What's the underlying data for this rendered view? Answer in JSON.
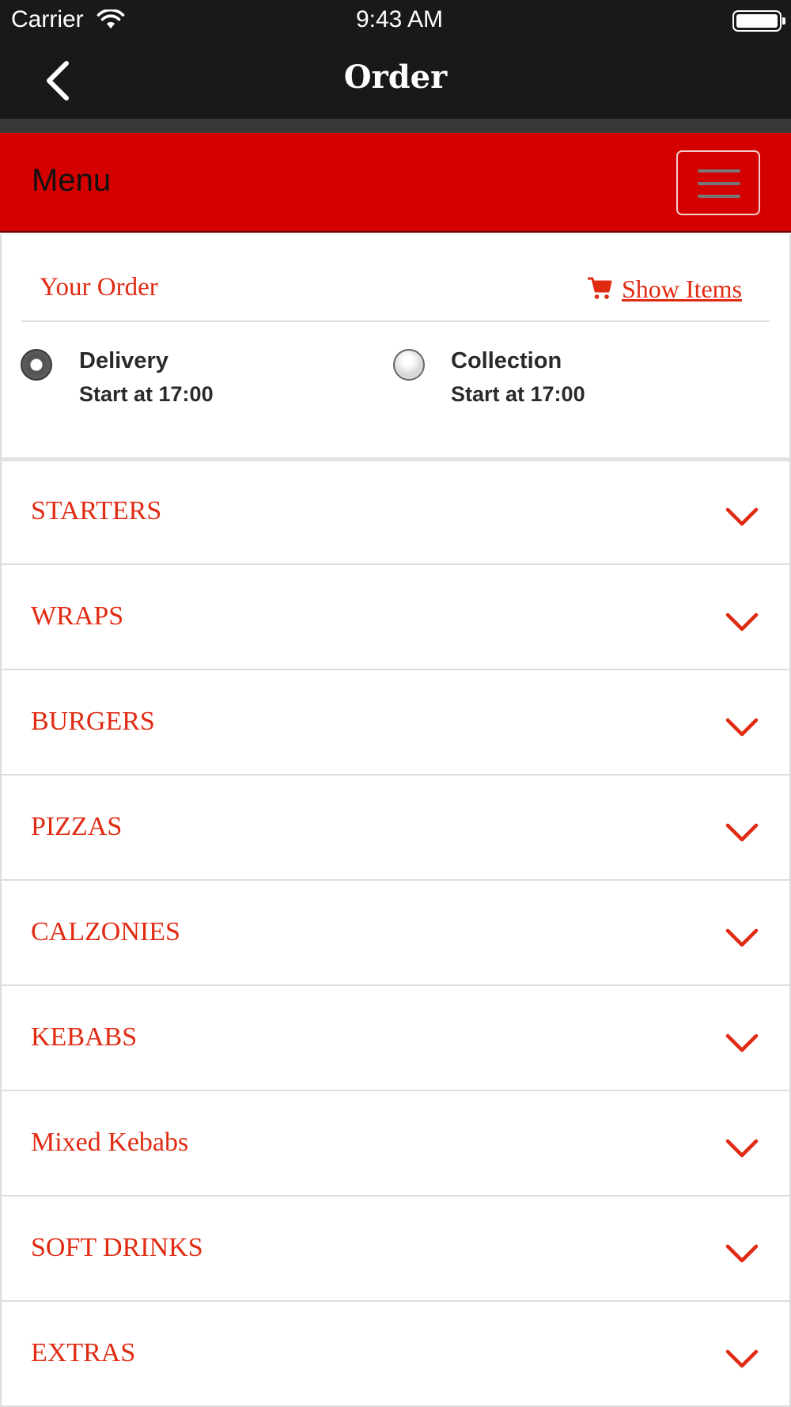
{
  "status_bar": {
    "carrier": "Carrier",
    "time": "9:43 AM"
  },
  "nav": {
    "title": "Order",
    "back_icon": "chevron-left-icon"
  },
  "menu_bar": {
    "label": "Menu",
    "toggle_icon": "hamburger-icon",
    "color": "#d40000"
  },
  "order": {
    "title": "Your Order",
    "show_items_label": "Show Items",
    "cart_icon": "cart-icon",
    "options": [
      {
        "label": "Delivery",
        "sub": "Start at 17:00",
        "selected": true
      },
      {
        "label": "Collection",
        "sub": "Start at 17:00",
        "selected": false
      }
    ]
  },
  "categories": [
    {
      "label": "STARTERS"
    },
    {
      "label": "WRAPS"
    },
    {
      "label": "BURGERS"
    },
    {
      "label": "PIZZAS"
    },
    {
      "label": "CALZONIES"
    },
    {
      "label": "KEBABS"
    },
    {
      "label": "Mixed Kebabs"
    },
    {
      "label": "SOFT DRINKS"
    },
    {
      "label": "EXTRAS"
    }
  ],
  "colors": {
    "accent": "#e02a12",
    "header": "#1a1818"
  }
}
